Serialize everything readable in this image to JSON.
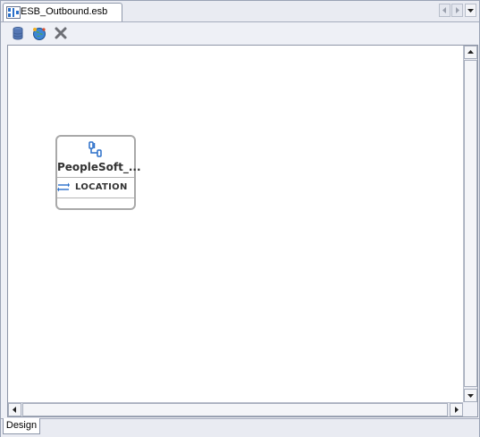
{
  "editor": {
    "tab_title": "ESB_Outbound.esb"
  },
  "toolbar": {
    "buttons": [
      {
        "name": "database-icon"
      },
      {
        "name": "globe-service-icon"
      },
      {
        "name": "delete-icon"
      }
    ]
  },
  "canvas": {
    "node": {
      "title": "PeopleSoft_...",
      "operation": "LOCATION"
    }
  },
  "bottom_tabs": {
    "design_label": "Design"
  },
  "colors": {
    "accent": "#2a6fc9",
    "node_border": "#a9a9a9"
  }
}
